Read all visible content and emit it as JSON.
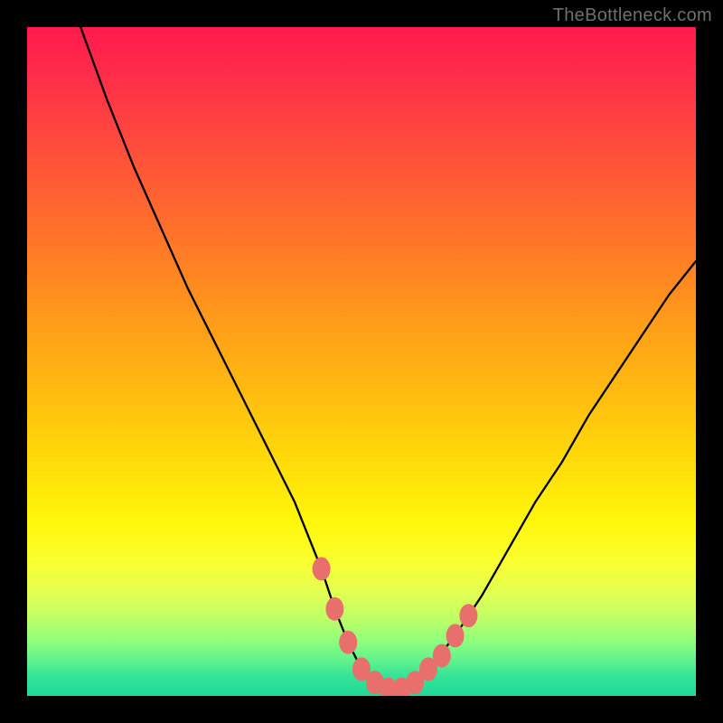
{
  "watermark": "TheBottleneck.com",
  "chart_data": {
    "type": "line",
    "title": "",
    "xlabel": "",
    "ylabel": "",
    "xlim": [
      0,
      100
    ],
    "ylim": [
      0,
      100
    ],
    "grid": false,
    "legend": false,
    "series": [
      {
        "name": "curve",
        "x": [
          8,
          12,
          16,
          20,
          24,
          28,
          32,
          36,
          40,
          42,
          44,
          46,
          48,
          50,
          52,
          54,
          56,
          58,
          60,
          64,
          68,
          72,
          76,
          80,
          84,
          88,
          92,
          96,
          100
        ],
        "y": [
          100,
          89,
          79,
          70,
          61,
          53,
          45,
          37,
          29,
          24,
          19,
          13,
          8,
          4,
          2,
          1,
          1,
          2,
          4,
          9,
          15,
          22,
          29,
          35,
          42,
          48,
          54,
          60,
          65
        ]
      }
    ],
    "markers": {
      "name": "highlight-points",
      "color": "#e86f6c",
      "points": [
        {
          "x": 44,
          "y": 19
        },
        {
          "x": 46,
          "y": 13
        },
        {
          "x": 48,
          "y": 8
        },
        {
          "x": 50,
          "y": 4
        },
        {
          "x": 52,
          "y": 2
        },
        {
          "x": 54,
          "y": 1
        },
        {
          "x": 56,
          "y": 1
        },
        {
          "x": 58,
          "y": 2
        },
        {
          "x": 60,
          "y": 4
        },
        {
          "x": 62,
          "y": 6
        },
        {
          "x": 64,
          "y": 9
        },
        {
          "x": 66,
          "y": 12
        }
      ]
    }
  }
}
